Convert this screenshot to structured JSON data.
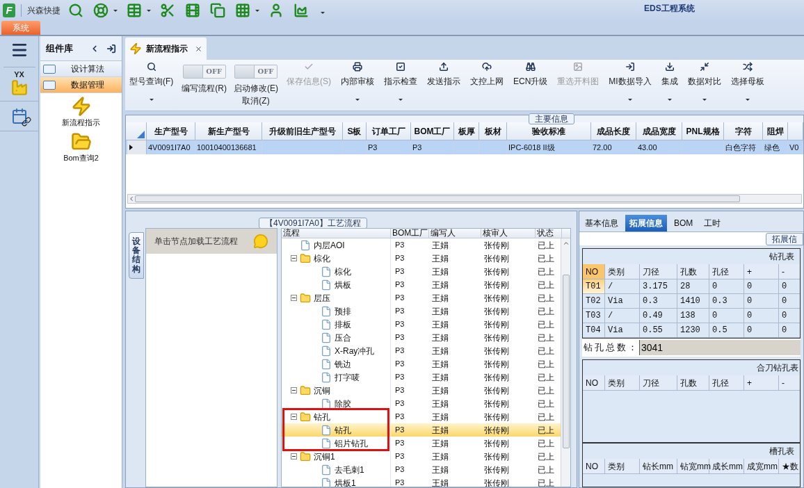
{
  "quick_toolbar": {
    "logo": "F",
    "app_name": "兴森快捷",
    "icons": [
      {
        "dropdown": false
      },
      {
        "dropdown": true
      },
      {
        "dropdown": true
      },
      {
        "dropdown": false
      },
      {
        "dropdown": false
      },
      {
        "dropdown": false
      },
      {
        "dropdown": true
      },
      {
        "dropdown": false
      },
      {
        "dropdown": false
      }
    ]
  },
  "window": {
    "title": "EDS工程系统"
  },
  "ribbon_tabs": [
    {
      "label": "系统",
      "selected": true
    }
  ],
  "side_strip": {
    "logo_text": "YX"
  },
  "library": {
    "title": "组件库",
    "groups": [
      {
        "label": "设计算法",
        "selected": false
      },
      {
        "label": "数据管理",
        "selected": true
      }
    ],
    "items": [
      {
        "kind": "bolt",
        "label": "新流程指示"
      },
      {
        "kind": "folder",
        "label": "Bom查询2"
      }
    ]
  },
  "doc_tabs": [
    {
      "label": "新流程指示",
      "selected": true
    }
  ],
  "toolbar": [
    {
      "kind": "button",
      "label": "型号查询(F)",
      "dropdown": true,
      "disabled": false
    },
    {
      "kind": "toggle",
      "label": "编写流程(R)",
      "switch_text": "OFF",
      "on": false
    },
    {
      "kind": "toggle",
      "label": "启动修改(E)",
      "label2": "取消(Z)",
      "switch_text": "OFF",
      "on": false
    },
    {
      "kind": "button",
      "label": "保存信息(S)",
      "dropdown": false,
      "disabled": true
    },
    {
      "kind": "button",
      "label": "内部审核",
      "dropdown": true,
      "disabled": false
    },
    {
      "kind": "button",
      "label": "指示检查",
      "dropdown": true,
      "disabled": false
    },
    {
      "kind": "button",
      "label": "发送指示",
      "dropdown": false,
      "disabled": false
    },
    {
      "kind": "button",
      "label": "文控上网",
      "dropdown": false,
      "disabled": false
    },
    {
      "kind": "button",
      "label": "ECN升级",
      "dropdown": false,
      "disabled": false
    },
    {
      "kind": "button",
      "label": "重选开料图",
      "dropdown": false,
      "disabled": true
    },
    {
      "kind": "button",
      "label": "MI数据导入",
      "dropdown": true,
      "disabled": false
    },
    {
      "kind": "button",
      "label": "集成",
      "dropdown": true,
      "disabled": false
    },
    {
      "kind": "button",
      "label": "数据对比",
      "dropdown": true,
      "disabled": false
    },
    {
      "kind": "button",
      "label": "选择母板",
      "dropdown": true,
      "disabled": false
    }
  ],
  "main_info": {
    "title": "主要信息",
    "columns": [
      "生产型号",
      "新生产型号",
      "升级前旧生产型号",
      "S板",
      "订单工厂",
      "BOM工厂",
      "板厚",
      "板材",
      "验收标准",
      "成品长度",
      "成品宽度",
      "PNL规格",
      "字符",
      "阻焊",
      null
    ],
    "rows": [
      {
        "selected": true,
        "cells": [
          "4V0091I7A0",
          "10010400136681",
          null,
          null,
          "P3",
          "P3",
          null,
          null,
          "IPC-6018 II级",
          "72.00",
          "43.00",
          null,
          "白色字符",
          "绿色",
          "V0"
        ]
      }
    ]
  },
  "process": {
    "title": "【4V0091I7A0】工艺流程",
    "side_tab": "设备结构",
    "hint": "单击节点加载工艺流程",
    "columns": [
      "流程",
      "BOM工厂",
      "编写人",
      "核审人",
      "状态"
    ],
    "rows": [
      {
        "kind": "leaf",
        "name": "内层AOI",
        "bom": "P3",
        "writer": "王娟",
        "reviewer": "张传刚",
        "status": "已上",
        "selected": false
      },
      {
        "kind": "folder",
        "name": "棕化",
        "bom": "P3",
        "writer": "王娟",
        "reviewer": "张传刚",
        "status": "已上",
        "selected": false,
        "expanded": true,
        "children": [
          {
            "kind": "leaf",
            "name": "棕化",
            "bom": "P3",
            "writer": "王娟",
            "reviewer": "张传刚",
            "status": "已上",
            "selected": false
          },
          {
            "kind": "leaf",
            "name": "烘板",
            "bom": "P3",
            "writer": "王娟",
            "reviewer": "张传刚",
            "status": "已上",
            "selected": false
          }
        ]
      },
      {
        "kind": "folder",
        "name": "层压",
        "bom": "P3",
        "writer": "王娟",
        "reviewer": "张传刚",
        "status": "已上",
        "selected": false,
        "expanded": true,
        "children": [
          {
            "kind": "leaf",
            "name": "预排",
            "bom": "P3",
            "writer": "王娟",
            "reviewer": "张传刚",
            "status": "已上",
            "selected": false
          },
          {
            "kind": "leaf",
            "name": "排板",
            "bom": "P3",
            "writer": "王娟",
            "reviewer": "张传刚",
            "status": "已上",
            "selected": false
          },
          {
            "kind": "leaf",
            "name": "压合",
            "bom": "P3",
            "writer": "王娟",
            "reviewer": "张传刚",
            "status": "已上",
            "selected": false
          },
          {
            "kind": "leaf",
            "name": "X-Ray冲孔",
            "bom": "P3",
            "writer": "王娟",
            "reviewer": "张传刚",
            "status": "已上",
            "selected": false
          },
          {
            "kind": "leaf",
            "name": "铣边",
            "bom": "P3",
            "writer": "王娟",
            "reviewer": "张传刚",
            "status": "已上",
            "selected": false
          },
          {
            "kind": "leaf",
            "name": "打字唛",
            "bom": "P3",
            "writer": "王娟",
            "reviewer": "张传刚",
            "status": "已上",
            "selected": false
          }
        ]
      },
      {
        "kind": "folder",
        "name": "沉铜",
        "bom": "P3",
        "writer": "王娟",
        "reviewer": "张传刚",
        "status": "已上",
        "selected": false,
        "expanded": true,
        "children": [
          {
            "kind": "leaf",
            "name": "除胶",
            "bom": "P3",
            "writer": "王娟",
            "reviewer": "张传刚",
            "status": "已上",
            "selected": false
          }
        ]
      },
      {
        "kind": "folder",
        "name": "钻孔",
        "bom": "P3",
        "writer": "王娟",
        "reviewer": "张传刚",
        "status": "已上",
        "selected": false,
        "expanded": true,
        "children": [
          {
            "kind": "leaf",
            "name": "钻孔",
            "bom": "P3",
            "writer": "王娟",
            "reviewer": "张传刚",
            "status": "已上",
            "selected": true
          },
          {
            "kind": "leaf",
            "name": "铝片钻孔",
            "bom": "P3",
            "writer": "王娟",
            "reviewer": "张传刚",
            "status": "已上",
            "selected": false
          }
        ]
      },
      {
        "kind": "folder",
        "name": "沉铜1",
        "bom": "P3",
        "writer": "王娟",
        "reviewer": "张传刚",
        "status": "已上",
        "selected": false,
        "expanded": true,
        "children": [
          {
            "kind": "leaf",
            "name": "去毛刺1",
            "bom": "P3",
            "writer": "王娟",
            "reviewer": "张传刚",
            "status": "已上",
            "selected": false
          },
          {
            "kind": "leaf",
            "name": "烘板1",
            "bom": "P3",
            "writer": "王娟",
            "reviewer": "张传刚",
            "status": "已上",
            "selected": false
          }
        ]
      }
    ]
  },
  "detail_tabs": [
    {
      "label": "基本信息",
      "selected": false
    },
    {
      "label": "拓展信息",
      "selected": true
    },
    {
      "label": "BOM",
      "selected": false
    },
    {
      "label": "工时",
      "selected": false
    }
  ],
  "detail_group": {
    "title": "拓展信"
  },
  "drill_table": {
    "title": "钻孔表",
    "columns": [
      "NO",
      "类别",
      "刀径",
      "孔数",
      "孔径",
      "+",
      "-"
    ],
    "rows": [
      {
        "selected": true,
        "cells": [
          "T01",
          "/",
          "3.175",
          "28",
          "0",
          "0",
          "0"
        ]
      },
      {
        "selected": false,
        "cells": [
          "T02",
          "Via",
          "0.3",
          "1410",
          "0.3",
          "0",
          "0"
        ]
      },
      {
        "selected": false,
        "cells": [
          "T03",
          "/",
          "0.49",
          "138",
          "0",
          "0",
          "0"
        ]
      },
      {
        "selected": false,
        "cells": [
          "T04",
          "Via",
          "0.55",
          "1230",
          "0.5",
          "0",
          "0"
        ]
      }
    ]
  },
  "drill_total": {
    "label": "钻孔总数：",
    "value": "3041"
  },
  "merged_table": {
    "title": "合刀钻孔表",
    "columns": [
      "NO",
      "类别",
      "刀径",
      "孔数",
      "孔径",
      "+",
      "-"
    ]
  },
  "slot_table": {
    "title": "槽孔表",
    "columns": [
      "NO",
      "类别",
      "钻长mm",
      "钻宽mm",
      "成长mm",
      "成宽mm",
      "★数"
    ]
  }
}
